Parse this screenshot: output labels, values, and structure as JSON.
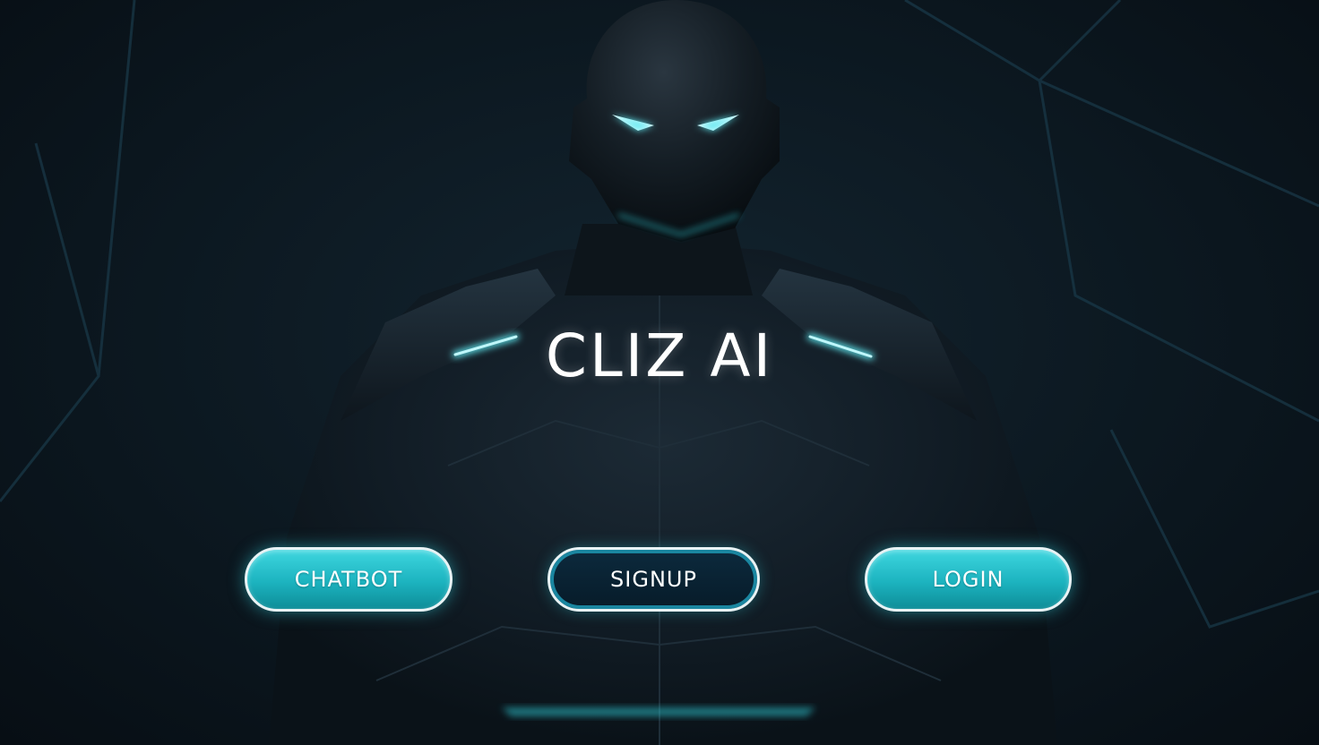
{
  "app": {
    "logo_main": "CLIZ AI"
  },
  "buttons": {
    "chatbot": "CHATBOT",
    "signup": "SIGNUP",
    "login": "LOGIN"
  },
  "colors": {
    "accent": "#2fc9d4",
    "background": "#0d1a23",
    "button_dark": "#0c2a3d",
    "button_border": "#e8f3f5"
  }
}
